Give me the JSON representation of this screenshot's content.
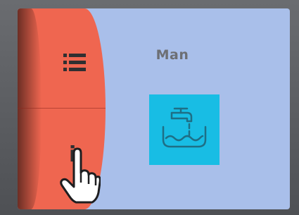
{
  "screen": {
    "title": "Man",
    "menu_icon": "list-menu-icon",
    "info_label": "i",
    "hand_icon": "pointing-hand-icon",
    "tile_icon": "tap-filling-basin-icon",
    "colors": {
      "side_panel": "#ef6650",
      "background": "#a9bfea",
      "tile": "#18bde4"
    }
  }
}
